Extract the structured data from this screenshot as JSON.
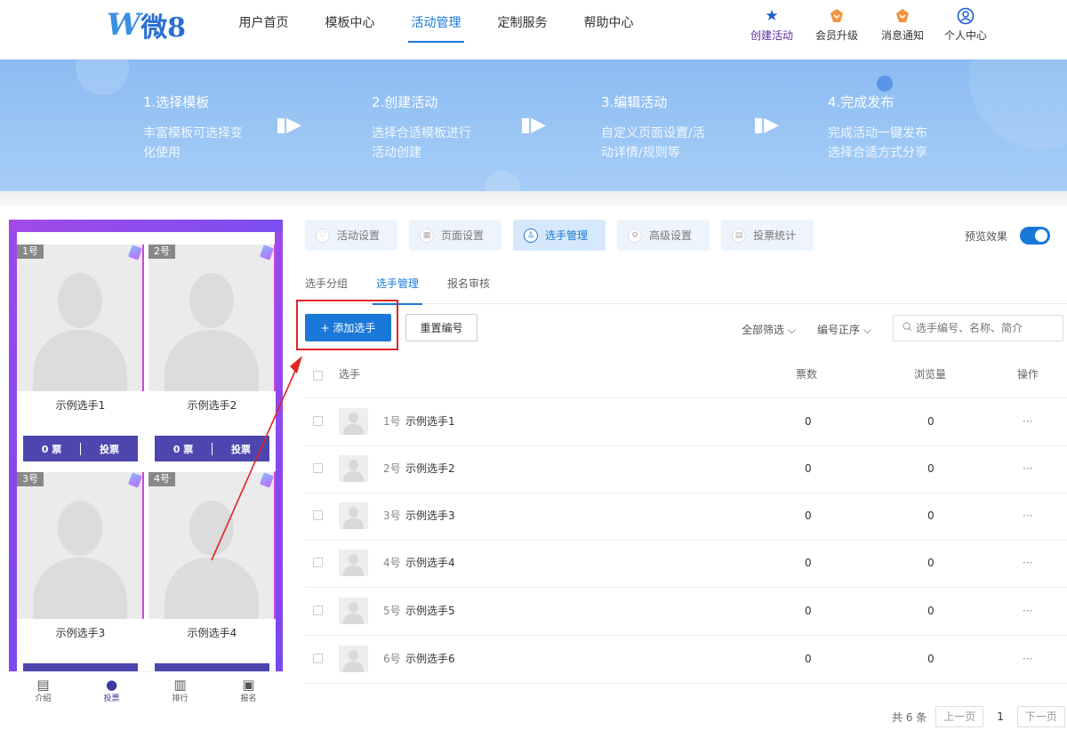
{
  "logo": {
    "mark": "W",
    "text": "微8"
  },
  "nav": {
    "items": [
      {
        "label": "用户首页"
      },
      {
        "label": "模板中心"
      },
      {
        "label": "活动管理"
      },
      {
        "label": "定制服务"
      },
      {
        "label": "帮助中心"
      }
    ],
    "active_index": 2,
    "quick": [
      {
        "label": "创建活动",
        "icon": "star-icon"
      },
      {
        "label": "会员升级",
        "icon": "crown-icon"
      },
      {
        "label": "消息通知",
        "icon": "bell-icon"
      },
      {
        "label": "个人中心",
        "icon": "user-icon"
      }
    ]
  },
  "banner": {
    "steps": [
      {
        "title": "1.选择模板",
        "desc": "丰富模板可选择变化使用"
      },
      {
        "title": "2.创建活动",
        "desc": "选择合适模板进行活动创建"
      },
      {
        "title": "3.编辑活动",
        "desc": "自定义页面设置/活动详情/规则等"
      },
      {
        "title": "4.完成发布",
        "desc": "完成活动一键发布选择合适方式分享"
      }
    ]
  },
  "preview": {
    "cards": [
      {
        "num": "1号",
        "name": "示例选手1",
        "votes": "0 票",
        "vote_btn": "投票"
      },
      {
        "num": "2号",
        "name": "示例选手2",
        "votes": "0 票",
        "vote_btn": "投票"
      },
      {
        "num": "3号",
        "name": "示例选手3",
        "votes": "",
        "vote_btn": ""
      },
      {
        "num": "4号",
        "name": "示例选手4",
        "votes": "",
        "vote_btn": ""
      }
    ],
    "tabbar": [
      {
        "label": "介绍",
        "icon": "document-icon"
      },
      {
        "label": "投票",
        "icon": "person-icon"
      },
      {
        "label": "排行",
        "icon": "ranking-icon"
      },
      {
        "label": "报名",
        "icon": "signup-icon"
      }
    ],
    "active_tab": 1
  },
  "settings_tabs": [
    {
      "label": "活动设置"
    },
    {
      "label": "页面设置"
    },
    {
      "label": "选手管理"
    },
    {
      "label": "高级设置"
    },
    {
      "label": "投票统计"
    }
  ],
  "settings_active": 2,
  "preview_toggle": {
    "label": "预览效果",
    "on": true
  },
  "subtabs": [
    {
      "label": "选手分组"
    },
    {
      "label": "选手管理"
    },
    {
      "label": "报名审核"
    }
  ],
  "subtab_active": 1,
  "toolbar": {
    "add_label": "+ 添加选手",
    "reset_label": "重置编号",
    "filter_all": "全部筛选",
    "sort_label": "编号正序",
    "search_placeholder": "选手编号、名称、简介"
  },
  "table": {
    "headers": {
      "player": "选手",
      "votes": "票数",
      "views": "浏览量",
      "actions": "操作"
    },
    "rows": [
      {
        "num": "1号",
        "name": "示例选手1",
        "votes": "0",
        "views": "0",
        "more": "···"
      },
      {
        "num": "2号",
        "name": "示例选手2",
        "votes": "0",
        "views": "0",
        "more": "···"
      },
      {
        "num": "3号",
        "name": "示例选手3",
        "votes": "0",
        "views": "0",
        "more": "···"
      },
      {
        "num": "4号",
        "name": "示例选手4",
        "votes": "0",
        "views": "0",
        "more": "···"
      },
      {
        "num": "5号",
        "name": "示例选手5",
        "votes": "0",
        "views": "0",
        "more": "···"
      },
      {
        "num": "6号",
        "name": "示例选手6",
        "votes": "0",
        "views": "0",
        "more": "···"
      }
    ]
  },
  "pagination": {
    "total": "共 6 条",
    "prev": "上一页",
    "page": "1",
    "next": "下一页"
  },
  "colors": {
    "accent": "#1a78d8",
    "highlight": "#e02424",
    "vote_bar": "#4d46ae"
  }
}
